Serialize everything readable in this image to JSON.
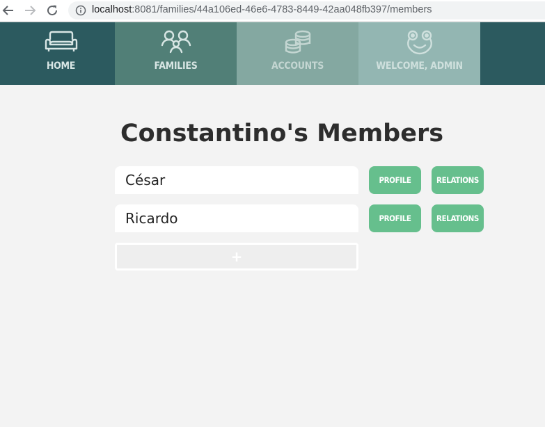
{
  "browser": {
    "url_host": "localhost",
    "url_rest": ":8081/families/44a106ed-46e6-4783-8449-42aa048fb397/members",
    "back_icon": "arrow-left-icon",
    "forward_icon": "arrow-right-icon",
    "reload_icon": "reload-icon",
    "info_icon": "info-icon"
  },
  "nav": {
    "tabs": [
      {
        "label": "HOME",
        "icon": "sofa-icon"
      },
      {
        "label": "FAMILIES",
        "icon": "people-icon"
      },
      {
        "label": "ACCOUNTS",
        "icon": "coins-icon"
      },
      {
        "label": "WELCOME, ADMIN",
        "icon": "frog-face-icon"
      }
    ],
    "active_tab": "FAMILIES"
  },
  "main": {
    "title": "Constantino's Members",
    "members": [
      {
        "name": "César",
        "profile_label": "PROFILE",
        "relations_label": "RELATIONS"
      },
      {
        "name": "Ricardo",
        "profile_label": "PROFILE",
        "relations_label": "RELATIONS"
      }
    ],
    "add_label": "+"
  },
  "colors": {
    "nav_bg": "#2c5a5f",
    "active_tab": "#517f77",
    "accent_green": "#66bf8d",
    "page_bg": "#f3f3f3"
  }
}
